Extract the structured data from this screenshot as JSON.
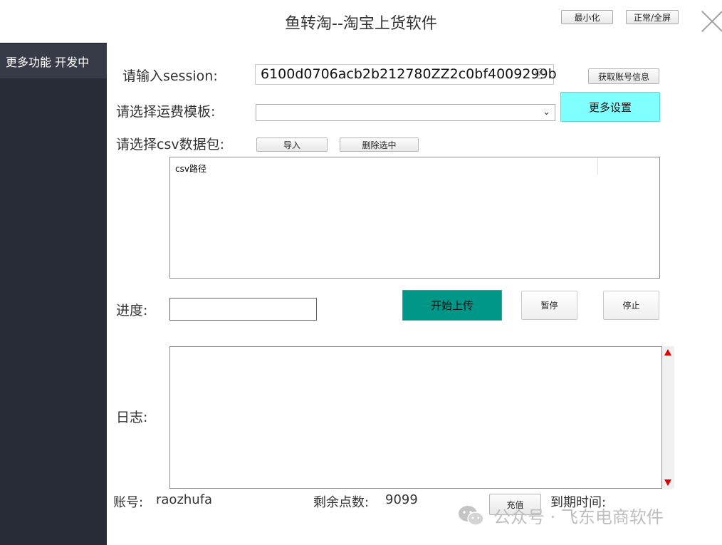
{
  "window": {
    "title": "鱼转淘--淘宝上货软件",
    "minimize_label": "最小化",
    "fullscreen_label": "正常/全屏"
  },
  "sidebar": {
    "items": [
      {
        "label": "更多功能 开发中"
      }
    ]
  },
  "form": {
    "session_label": "请输入session:",
    "session_value": "6100d0706acb2b212780ZZ2c0bf4009299b",
    "get_account_label": "获取账号信息",
    "more_settings_label": "更多设置",
    "shipping_label": "请选择运费模板:",
    "shipping_value": "",
    "csv_label": "请选择csv数据包:",
    "import_label": "导入",
    "delete_selected_label": "删除选中",
    "csv_column_header": "csv路径",
    "progress_label": "进度:",
    "start_upload_label": "开始上传",
    "pause_label": "暂停",
    "stop_label": "停止",
    "log_label": "日志:"
  },
  "footer": {
    "account_label": "账号:",
    "account_value": "raozhufa",
    "points_label": "剩余点数:",
    "points_value": "9099",
    "recharge_label": "充值",
    "expiry_label": "到期时间:"
  },
  "watermark": {
    "text": "公众号 · 飞东电商软件",
    "icon": "wechat-icon"
  },
  "colors": {
    "sidebar_bg": "#282c37",
    "sidebar_item_bg": "#373b47",
    "more_settings_bg": "#80ffff",
    "start_button_bg": "#009688",
    "scroll_arrow": "#e00000"
  }
}
